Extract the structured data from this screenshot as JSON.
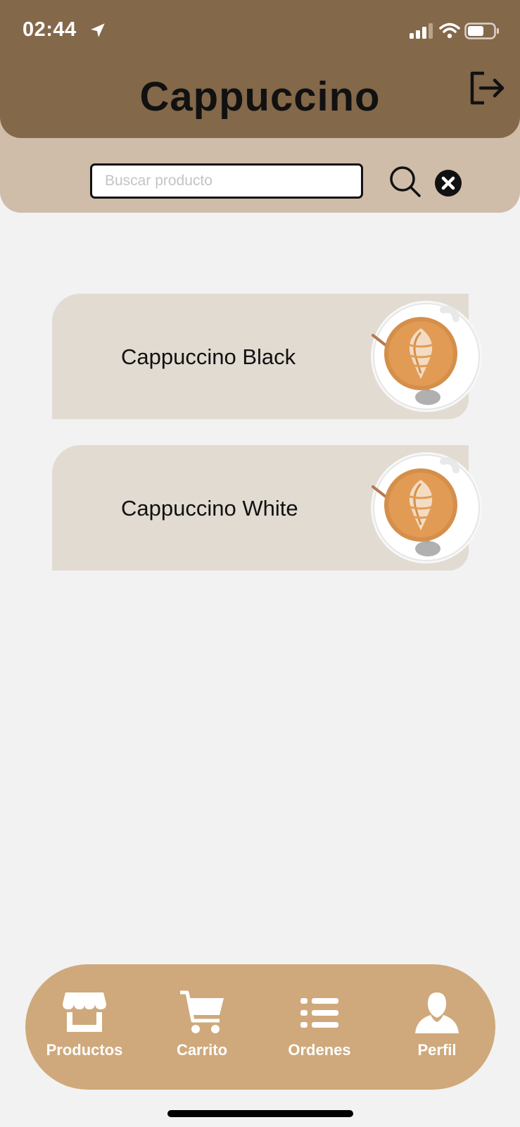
{
  "status_bar": {
    "time": "02:44",
    "icons": [
      "location-arrow-icon",
      "signal-bars-icon",
      "wifi-icon",
      "battery-icon"
    ]
  },
  "header": {
    "title": "Cappuccino",
    "logout_icon": "logout-icon"
  },
  "search": {
    "placeholder": "Buscar producto",
    "value": "",
    "search_icon": "magnifier-icon",
    "clear_icon": "close-circle-icon"
  },
  "products": [
    {
      "name": "Cappuccino Black",
      "image": "cappuccino-cup"
    },
    {
      "name": "Cappuccino White",
      "image": "cappuccino-cup"
    }
  ],
  "bottom_nav": {
    "items": [
      {
        "label": "Productos",
        "icon": "store-icon"
      },
      {
        "label": "Carrito",
        "icon": "cart-icon"
      },
      {
        "label": "Ordenes",
        "icon": "list-icon"
      },
      {
        "label": "Perfil",
        "icon": "user-icon"
      }
    ]
  },
  "colors": {
    "header": "#84684a",
    "search_band": "#cfbca9",
    "card": "#e2dbd2",
    "nav": "#cfa97b",
    "background": "#f2f2f2"
  }
}
